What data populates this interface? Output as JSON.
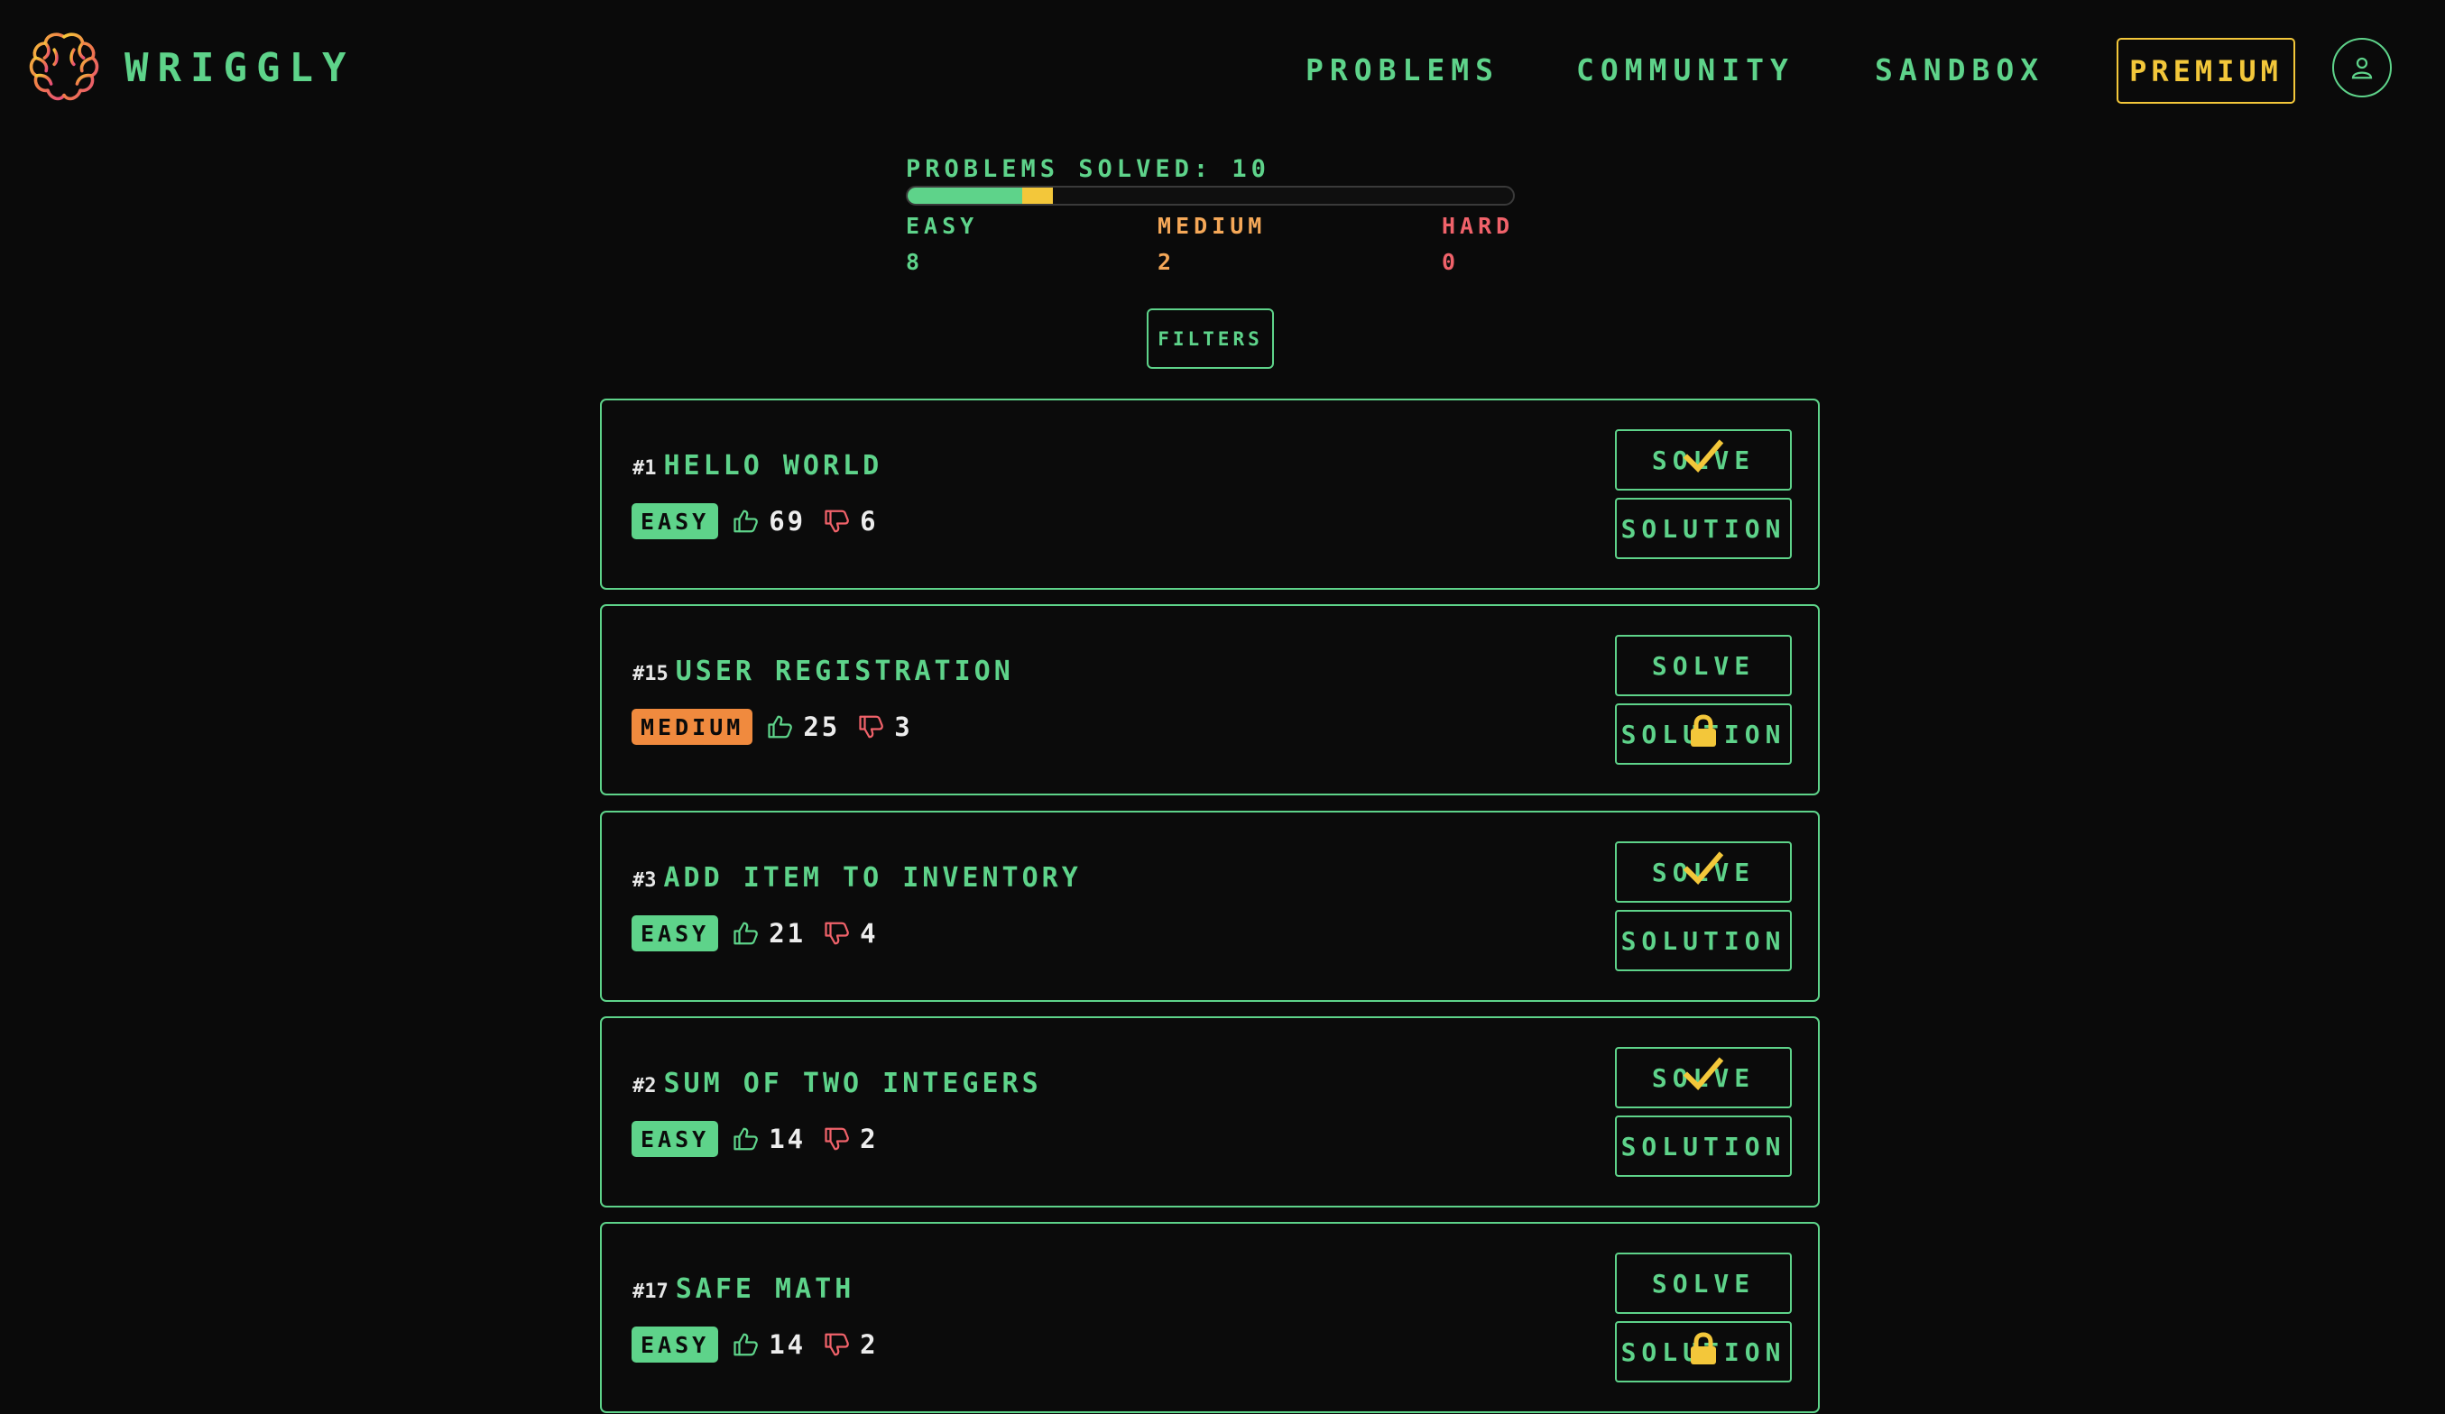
{
  "app": {
    "name": "Wriggly"
  },
  "nav": {
    "problems": "Problems",
    "community": "Community",
    "sandbox": "Sandbox",
    "premium": "Premium"
  },
  "stats": {
    "title": "Problems solved: 10",
    "easy_label": "Easy",
    "easy_value": "8",
    "medium_label": "Medium",
    "medium_value": "2",
    "hard_label": "Hard",
    "hard_value": "0",
    "easy_fraction": 0.19,
    "medium_fraction": 0.05
  },
  "filters_label": "Filters",
  "colors": {
    "accent": "#5ed38a",
    "premium": "#f3c73a",
    "easy": "#5ed38a",
    "medium": "#f5a858",
    "medium_badge": "#f08a3e",
    "hard": "#f0626a",
    "dislike": "#f0626a",
    "background": "#0a0a0a"
  },
  "problems": [
    {
      "number": "#1",
      "title": "Hello World",
      "difficulty": "Easy",
      "likes": "69",
      "dislikes": "6",
      "solve_label": "Solve",
      "solution_label": "Solution",
      "solved": true,
      "solution_locked": false
    },
    {
      "number": "#15",
      "title": "User Registration",
      "difficulty": "Medium",
      "likes": "25",
      "dislikes": "3",
      "solve_label": "Solve",
      "solution_label": "Solution",
      "solved": false,
      "solution_locked": true
    },
    {
      "number": "#3",
      "title": "Add item to inventory",
      "difficulty": "Easy",
      "likes": "21",
      "dislikes": "4",
      "solve_label": "Solve",
      "solution_label": "Solution",
      "solved": true,
      "solution_locked": false
    },
    {
      "number": "#2",
      "title": "Sum of two integers",
      "difficulty": "Easy",
      "likes": "14",
      "dislikes": "2",
      "solve_label": "Solve",
      "solution_label": "Solution",
      "solved": true,
      "solution_locked": false
    },
    {
      "number": "#17",
      "title": "Safe math",
      "difficulty": "Easy",
      "likes": "14",
      "dislikes": "2",
      "solve_label": "Solve",
      "solution_label": "Solution",
      "solved": false,
      "solution_locked": true
    }
  ],
  "icons": {
    "logo": "brain-icon",
    "user": "user-icon",
    "like": "thumbs-up-icon",
    "dislike": "thumbs-down-icon",
    "solved": "checkmark-icon",
    "locked": "lock-icon"
  }
}
